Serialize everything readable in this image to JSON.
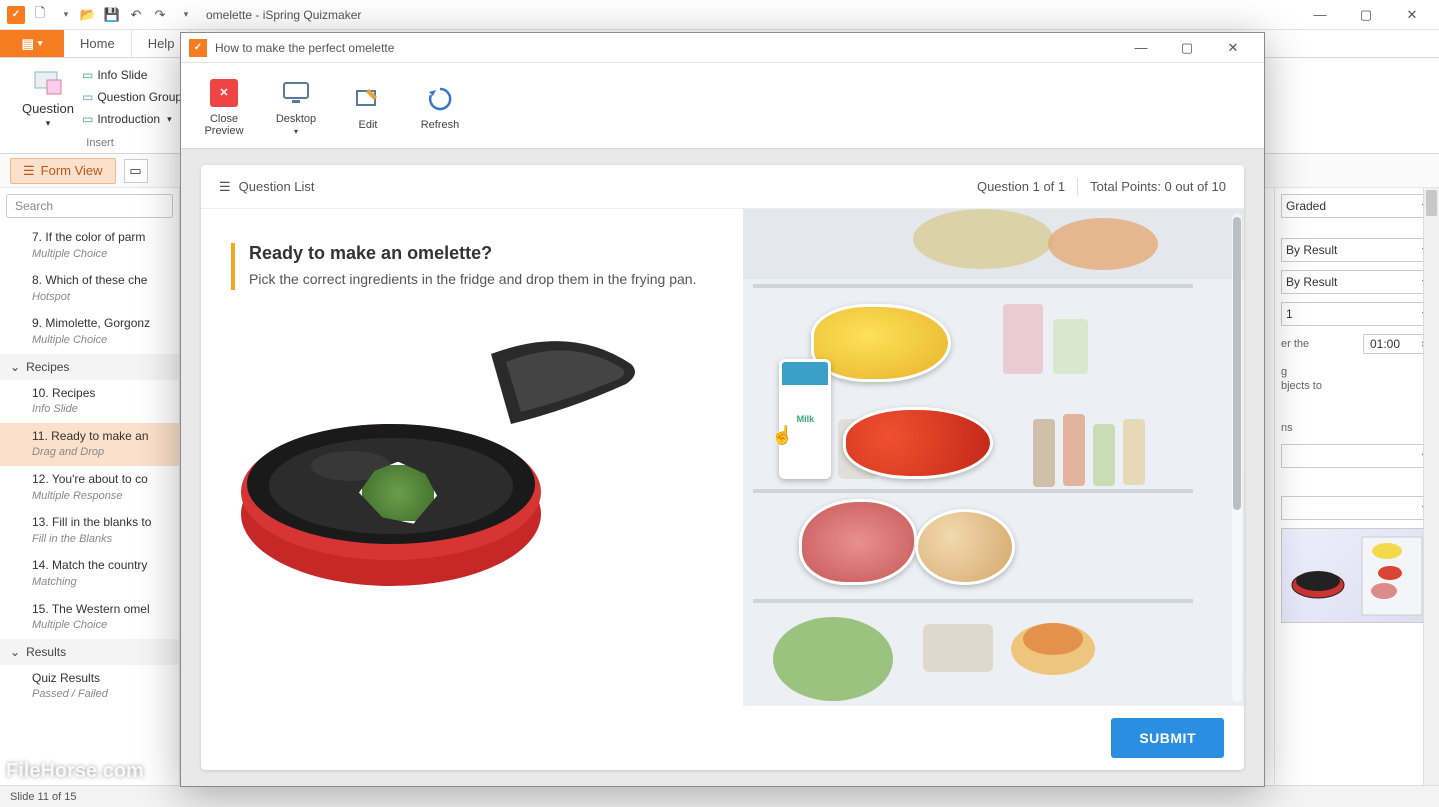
{
  "mainWindow": {
    "title": "omelette - iSpring Quizmaker",
    "tabs": {
      "file": "",
      "home": "Home",
      "help": "Help"
    },
    "ribbon": {
      "question": "Question",
      "infoSlide": "Info Slide",
      "questionGroup": "Question Group",
      "introduction": "Introduction",
      "insert": "Insert"
    },
    "formView": "Form View",
    "search": "Search"
  },
  "slides": {
    "s7": {
      "num": "7.",
      "title": "If the color of parm",
      "sub": "Multiple Choice"
    },
    "s8": {
      "num": "8.",
      "title": "Which of these che",
      "sub": "Hotspot"
    },
    "s9": {
      "num": "9.",
      "title": "Mimolette, Gorgonz",
      "sub": "Multiple Choice"
    },
    "sectionRecipes": "Recipes",
    "s10": {
      "num": "10.",
      "title": "Recipes",
      "sub": "Info Slide"
    },
    "s11": {
      "num": "11.",
      "title": "Ready to make an",
      "sub": "Drag and Drop"
    },
    "s12": {
      "num": "12.",
      "title": "You're about to co",
      "sub": "Multiple Response"
    },
    "s13": {
      "num": "13.",
      "title": "Fill in the blanks to",
      "sub": "Fill in the Blanks"
    },
    "s14": {
      "num": "14.",
      "title": "Match the country",
      "sub": "Matching"
    },
    "s15": {
      "num": "15.",
      "title": "The Western omel",
      "sub": "Multiple Choice"
    },
    "sectionResults": "Results",
    "quizResults": {
      "title": "Quiz Results",
      "sub": "Passed / Failed"
    }
  },
  "rightPanel": {
    "graded": "Graded",
    "byResult1": "By Result",
    "byResult2": "By Result",
    "number": "1",
    "afterThe": "er the",
    "time": "01:00",
    "g": "g",
    "objectsTo": "bjects to",
    "ns": "ns"
  },
  "status": "Slide 11 of 15",
  "preview": {
    "title": "How to make the perfect omelette",
    "ribbon": {
      "closePreview": "Close\nPreview",
      "desktop": "Desktop",
      "edit": "Edit",
      "refresh": "Refresh"
    },
    "head": {
      "questionList": "Question List",
      "counter": "Question 1 of 1",
      "points": "Total Points: 0 out of 10"
    },
    "question": {
      "title": "Ready to make an omelette?",
      "sub": "Pick the correct ingredients in the fridge and drop them in the frying pan."
    },
    "submit": "SUBMIT"
  },
  "watermark": "FileHorse.com"
}
